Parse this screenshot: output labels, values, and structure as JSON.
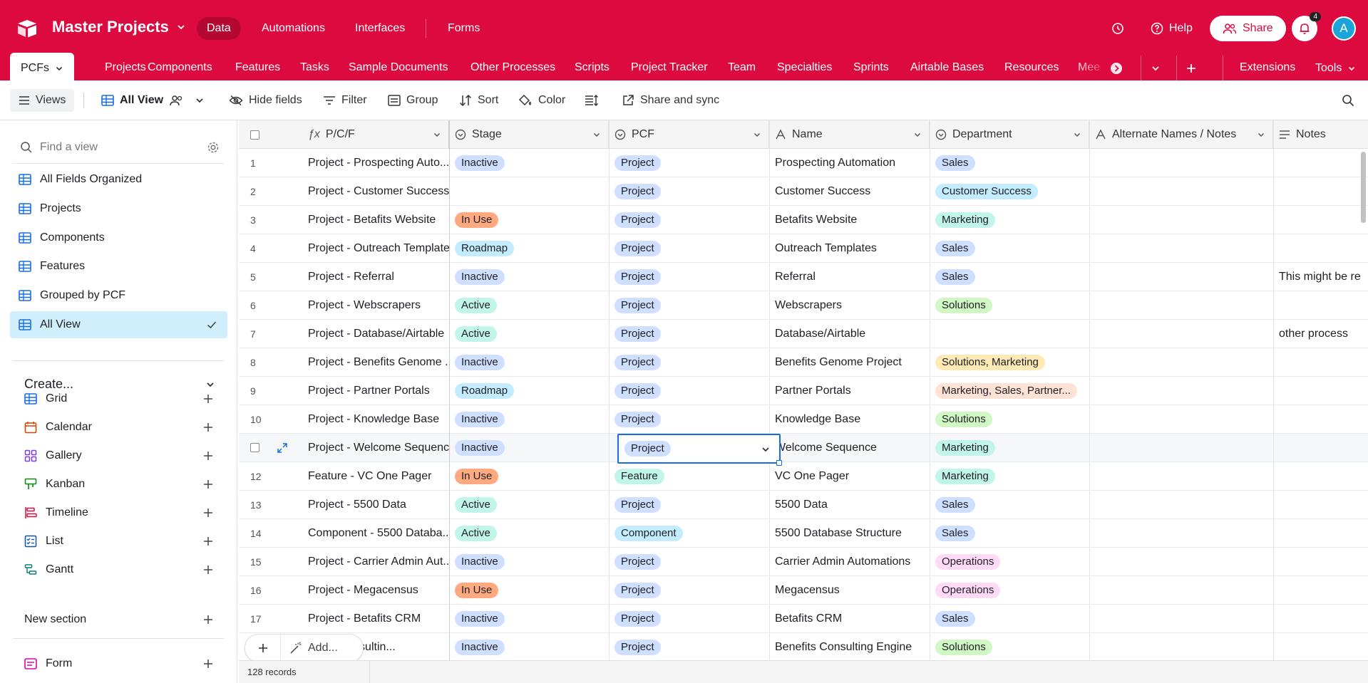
{
  "topbar": {
    "base_name": "Master Projects",
    "nav": [
      {
        "label": "Data",
        "active": true
      },
      {
        "label": "Automations",
        "active": false
      },
      {
        "label": "Interfaces",
        "active": false
      },
      {
        "label": "Forms",
        "active": false
      }
    ],
    "help_label": "Help",
    "share_label": "Share",
    "notification_count": "4",
    "avatar_initial": "A",
    "brand_color": "#dc0a3f"
  },
  "tabs": [
    {
      "label": "PCFs",
      "active": true
    },
    {
      "label": "Projects"
    },
    {
      "label": "Components"
    },
    {
      "label": "Features"
    },
    {
      "label": "Tasks"
    },
    {
      "label": "Sample Documents"
    },
    {
      "label": "Other Processes"
    },
    {
      "label": "Scripts"
    },
    {
      "label": "Project Tracker"
    },
    {
      "label": "Team"
    },
    {
      "label": "Specialties"
    },
    {
      "label": "Sprints"
    },
    {
      "label": "Airtable Bases"
    },
    {
      "label": "Resources"
    },
    {
      "label": "Mee"
    }
  ],
  "tab_right": {
    "extensions_label": "Extensions",
    "tools_label": "Tools"
  },
  "toolbar": {
    "views_label": "Views",
    "view_name": "All View",
    "hide_fields_label": "Hide fields",
    "filter_label": "Filter",
    "group_label": "Group",
    "sort_label": "Sort",
    "color_label": "Color",
    "share_sync_label": "Share and sync"
  },
  "sidebar": {
    "find_placeholder": "Find a view",
    "views": [
      {
        "label": "All Fields Organized",
        "active": false
      },
      {
        "label": "Projects",
        "active": false
      },
      {
        "label": "Components",
        "active": false
      },
      {
        "label": "Features",
        "active": false
      },
      {
        "label": "Grouped by PCF",
        "active": false
      },
      {
        "label": "All View",
        "active": true
      }
    ],
    "create_label": "Create...",
    "create_items": [
      {
        "label": "Grid",
        "icon": "grid-icon"
      },
      {
        "label": "Calendar",
        "icon": "calendar-icon"
      },
      {
        "label": "Gallery",
        "icon": "gallery-icon"
      },
      {
        "label": "Kanban",
        "icon": "kanban-icon"
      },
      {
        "label": "Timeline",
        "icon": "timeline-icon"
      },
      {
        "label": "List",
        "icon": "list-icon"
      },
      {
        "label": "Gantt",
        "icon": "gantt-icon"
      }
    ],
    "new_section_label": "New section",
    "form_label": "Form"
  },
  "grid": {
    "columns": [
      "P/C/F",
      "Stage",
      "PCF",
      "Name",
      "Department",
      "Alternate Names / Notes",
      "Notes"
    ],
    "rows": [
      {
        "n": "1",
        "pcf_name": "Project - Prospecting Auto...",
        "stage": "Inactive",
        "pcf": "Project",
        "name": "Prospecting Automation",
        "dept": "Sales",
        "notes": ""
      },
      {
        "n": "2",
        "pcf_name": "Project - Customer Success",
        "stage": "",
        "pcf": "Project",
        "name": "Customer Success",
        "dept": "Customer Success",
        "notes": ""
      },
      {
        "n": "3",
        "pcf_name": "Project - Betafits Website",
        "stage": "In Use",
        "pcf": "Project",
        "name": "Betafits Website",
        "dept": "Marketing",
        "notes": ""
      },
      {
        "n": "4",
        "pcf_name": "Project - Outreach Templates",
        "stage": "Roadmap",
        "pcf": "Project",
        "name": "Outreach Templates",
        "dept": "Sales",
        "notes": ""
      },
      {
        "n": "5",
        "pcf_name": "Project - Referral",
        "stage": "Inactive",
        "pcf": "Project",
        "name": "Referral",
        "dept": "Sales",
        "notes": "This might be re"
      },
      {
        "n": "6",
        "pcf_name": "Project - Webscrapers",
        "stage": "Active",
        "pcf": "Project",
        "name": "Webscrapers",
        "dept": "Solutions",
        "notes": ""
      },
      {
        "n": "7",
        "pcf_name": "Project - Database/Airtable",
        "stage": "Active",
        "pcf": "Project",
        "name": "Database/Airtable",
        "dept": "",
        "notes": "other process"
      },
      {
        "n": "8",
        "pcf_name": "Project - Benefits Genome ...",
        "stage": "Inactive",
        "pcf": "Project",
        "name": "Benefits Genome Project",
        "dept": "Solutions, Marketing",
        "notes": ""
      },
      {
        "n": "9",
        "pcf_name": "Project - Partner Portals",
        "stage": "Roadmap",
        "pcf": "Project",
        "name": "Partner Portals",
        "dept": "Marketing, Sales, Partner...",
        "notes": ""
      },
      {
        "n": "10",
        "pcf_name": "Project - Knowledge Base",
        "stage": "Inactive",
        "pcf": "Project",
        "name": "Knowledge Base",
        "dept": "Solutions",
        "notes": ""
      },
      {
        "n": "",
        "pcf_name": "Project - Welcome Sequence",
        "stage": "Inactive",
        "pcf": "Project",
        "name": "Welcome Sequence",
        "dept": "Marketing",
        "notes": ""
      },
      {
        "n": "12",
        "pcf_name": "Feature - VC One Pager",
        "stage": "In Use",
        "pcf": "Feature",
        "name": "VC One Pager",
        "dept": "Marketing",
        "notes": ""
      },
      {
        "n": "13",
        "pcf_name": "Project - 5500 Data",
        "stage": "Active",
        "pcf": "Project",
        "name": "5500 Data",
        "dept": "Sales",
        "notes": ""
      },
      {
        "n": "14",
        "pcf_name": "Component - 5500 Databa...",
        "stage": "Active",
        "pcf": "Component",
        "name": "5500 Database Structure",
        "dept": "Sales",
        "notes": ""
      },
      {
        "n": "15",
        "pcf_name": "Project - Carrier Admin Aut...",
        "stage": "Inactive",
        "pcf": "Project",
        "name": "Carrier Admin Automations",
        "dept": "Operations",
        "notes": ""
      },
      {
        "n": "16",
        "pcf_name": "Project - Megacensus",
        "stage": "In Use",
        "pcf": "Project",
        "name": "Megacensus",
        "dept": "Operations",
        "notes": ""
      },
      {
        "n": "17",
        "pcf_name": "Project - Betafits CRM",
        "stage": "Inactive",
        "pcf": "Project",
        "name": "Betafits CRM",
        "dept": "Sales",
        "notes": ""
      },
      {
        "n": "",
        "pcf_name": "nefits Consultin...",
        "stage": "Inactive",
        "pcf": "Project",
        "name": "Benefits Consulting Engine",
        "dept": "Solutions",
        "notes": ""
      }
    ],
    "record_count": "128 records",
    "add_label": "Add...",
    "pill_colors": {
      "Inactive": "#cfdfff",
      "In Use": "#ffa981",
      "Roadmap": "#c4ecff",
      "Active": "#c2f5e9",
      "Project": "#cfdfff",
      "Feature": "#c2f5e9",
      "Component": "#c4ecff",
      "Sales": "#cfdfff",
      "Customer Success": "#c4ecff",
      "Marketing": "#c2f5e9",
      "Solutions": "#d1f7c4",
      "Solutions, Marketing": "#ffeab6",
      "Marketing, Sales, Partner...": "#fee2d5",
      "Operations": "#ffdaf6"
    }
  }
}
